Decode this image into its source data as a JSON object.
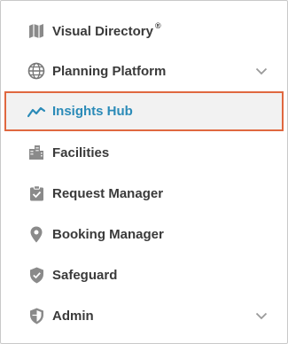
{
  "nav": {
    "items": [
      {
        "label": "Visual Directory",
        "trademark": "®",
        "icon": "map-icon",
        "expandable": false,
        "active": false
      },
      {
        "label": "Planning Platform",
        "icon": "globe-icon",
        "expandable": true,
        "active": false
      },
      {
        "label": "Insights Hub",
        "icon": "trend-line-icon",
        "expandable": false,
        "active": true
      },
      {
        "label": "Facilities",
        "icon": "buildings-icon",
        "expandable": false,
        "active": false
      },
      {
        "label": "Request Manager",
        "icon": "clipboard-check-icon",
        "expandable": false,
        "active": false
      },
      {
        "label": "Booking Manager",
        "icon": "location-pin-icon",
        "expandable": false,
        "active": false
      },
      {
        "label": "Safeguard",
        "icon": "shield-check-icon",
        "expandable": false,
        "active": false
      },
      {
        "label": "Admin",
        "icon": "shield-half-icon",
        "expandable": true,
        "active": false
      }
    ]
  },
  "colors": {
    "icon": "#8a8a8a",
    "label": "#3a3a3a",
    "active_label": "#2b8bb8",
    "highlight_border": "#e06840",
    "active_bg": "#f2f2f2",
    "chevron": "#9a9a9a"
  }
}
